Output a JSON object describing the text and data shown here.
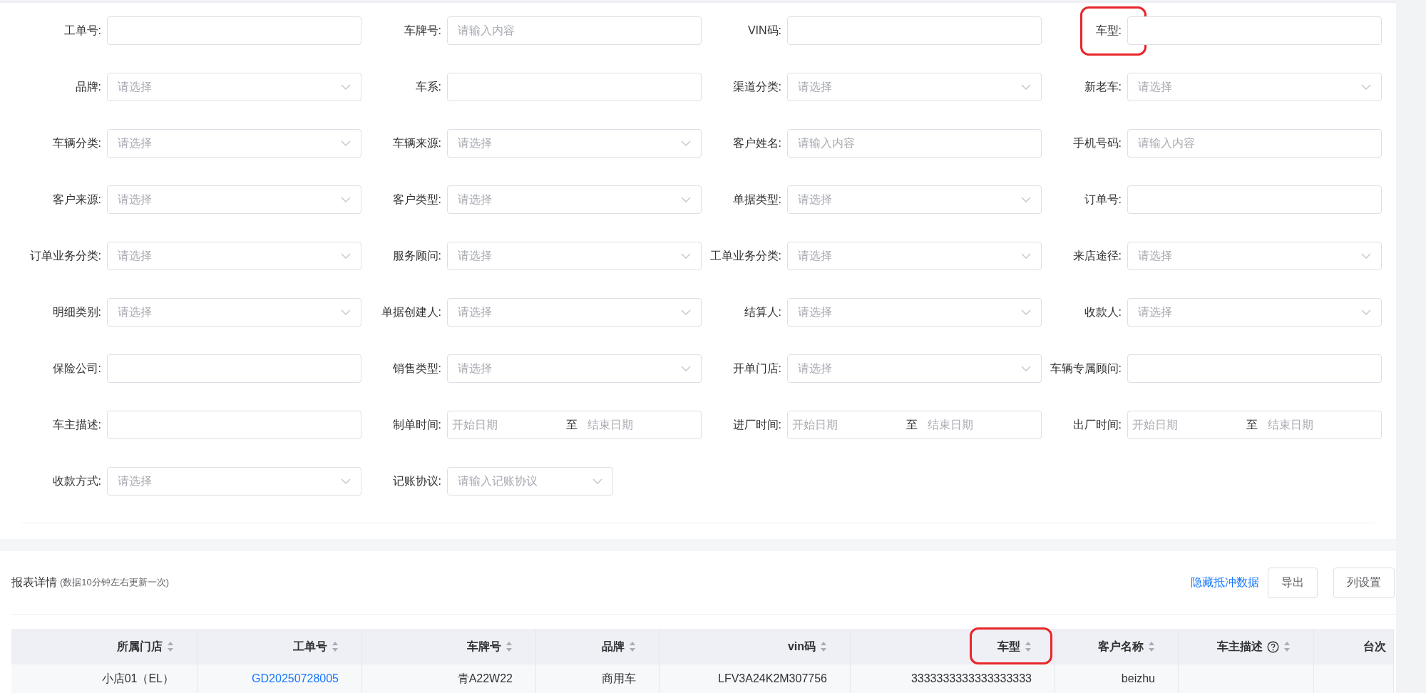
{
  "form": {
    "fields": [
      {
        "label": "工单号:",
        "kind": "text",
        "highlighted": false
      },
      {
        "label": "车牌号:",
        "kind": "text",
        "placeholder": "请输入内容",
        "highlighted": false
      },
      {
        "label": "VIN码:",
        "kind": "text",
        "highlighted": false
      },
      {
        "label": "车型:",
        "kind": "text",
        "highlighted": true
      },
      {
        "label": "品牌:",
        "kind": "select",
        "placeholder": "请选择",
        "highlighted": false
      },
      {
        "label": "车系:",
        "kind": "text",
        "highlighted": false
      },
      {
        "label": "渠道分类:",
        "kind": "select",
        "placeholder": "请选择",
        "highlighted": false
      },
      {
        "label": "新老车:",
        "kind": "select",
        "placeholder": "请选择",
        "highlighted": false
      },
      {
        "label": "车辆分类:",
        "kind": "select",
        "placeholder": "请选择",
        "highlighted": false
      },
      {
        "label": "车辆来源:",
        "kind": "select",
        "placeholder": "请选择",
        "highlighted": false
      },
      {
        "label": "客户姓名:",
        "kind": "text",
        "placeholder": "请输入内容",
        "highlighted": false
      },
      {
        "label": "手机号码:",
        "kind": "text",
        "placeholder": "请输入内容",
        "highlighted": false
      },
      {
        "label": "客户来源:",
        "kind": "select",
        "placeholder": "请选择",
        "highlighted": false
      },
      {
        "label": "客户类型:",
        "kind": "select",
        "placeholder": "请选择",
        "highlighted": false
      },
      {
        "label": "单据类型:",
        "kind": "select",
        "placeholder": "请选择",
        "highlighted": false
      },
      {
        "label": "订单号:",
        "kind": "text",
        "highlighted": false
      },
      {
        "label": "订单业务分类:",
        "kind": "select",
        "placeholder": "请选择",
        "highlighted": false
      },
      {
        "label": "服务顾问:",
        "kind": "select",
        "placeholder": "请选择",
        "highlighted": false
      },
      {
        "label": "工单业务分类:",
        "kind": "select",
        "placeholder": "请选择",
        "highlighted": false
      },
      {
        "label": "来店途径:",
        "kind": "select",
        "placeholder": "请选择",
        "highlighted": false
      },
      {
        "label": "明细类别:",
        "kind": "select",
        "placeholder": "请选择",
        "highlighted": false
      },
      {
        "label": "单据创建人:",
        "kind": "select",
        "placeholder": "请选择",
        "highlighted": false
      },
      {
        "label": "结算人:",
        "kind": "select",
        "placeholder": "请选择",
        "highlighted": false
      },
      {
        "label": "收款人:",
        "kind": "select",
        "placeholder": "请选择",
        "highlighted": false
      },
      {
        "label": "保险公司:",
        "kind": "text",
        "highlighted": false
      },
      {
        "label": "销售类型:",
        "kind": "select",
        "placeholder": "请选择",
        "highlighted": false
      },
      {
        "label": "开单门店:",
        "kind": "select",
        "placeholder": "请选择",
        "highlighted": false
      },
      {
        "label": "车辆专属顾问:",
        "kind": "text",
        "highlighted": false
      },
      {
        "label": "车主描述:",
        "kind": "text",
        "highlighted": false
      },
      {
        "label": "制单时间:",
        "kind": "daterange",
        "start_placeholder": "开始日期",
        "separator": "至",
        "end_placeholder": "结束日期",
        "highlighted": false
      },
      {
        "label": "进厂时间:",
        "kind": "daterange",
        "start_placeholder": "开始日期",
        "separator": "至",
        "end_placeholder": "结束日期",
        "highlighted": false
      },
      {
        "label": "出厂时间:",
        "kind": "daterange",
        "start_placeholder": "开始日期",
        "separator": "至",
        "end_placeholder": "结束日期",
        "highlighted": false
      },
      {
        "label": "收款方式:",
        "kind": "select",
        "placeholder": "请选择",
        "highlighted": false
      },
      {
        "label": "记账协议:",
        "kind": "combo",
        "placeholder": "请输入记账协议",
        "highlighted": false
      }
    ]
  },
  "report": {
    "title": "报表详情",
    "note": "(数据10分钟左右更新一次)",
    "link": "隐藏抵冲数据",
    "buttons": [
      "导出",
      "列设置"
    ]
  },
  "table": {
    "columns": [
      {
        "label": "所属门店",
        "sortable": true,
        "help": false,
        "highlighted": false
      },
      {
        "label": "工单号",
        "sortable": true,
        "help": false,
        "highlighted": false
      },
      {
        "label": "车牌号",
        "sortable": true,
        "help": false,
        "highlighted": false
      },
      {
        "label": "品牌",
        "sortable": true,
        "help": false,
        "highlighted": false
      },
      {
        "label": "vin码",
        "sortable": true,
        "help": false,
        "highlighted": false
      },
      {
        "label": "车型",
        "sortable": true,
        "help": false,
        "highlighted": true
      },
      {
        "label": "客户名称",
        "sortable": true,
        "help": false,
        "highlighted": false
      },
      {
        "label": "车主描述",
        "sortable": true,
        "help": true,
        "highlighted": false
      },
      {
        "label": "台次",
        "sortable": false,
        "help": false,
        "highlighted": false
      }
    ],
    "rows": [
      {
        "cells": [
          {
            "text": "小店01（EL）",
            "link": false
          },
          {
            "text": "GD20250728005",
            "link": true
          },
          {
            "text": "青A22W22",
            "link": false
          },
          {
            "text": "商用车",
            "link": false
          },
          {
            "text": "LFV3A24K2M307756",
            "link": false
          },
          {
            "text": "3333333333333333333",
            "link": false
          },
          {
            "text": "beizhu",
            "link": false
          }
        ]
      }
    ]
  }
}
